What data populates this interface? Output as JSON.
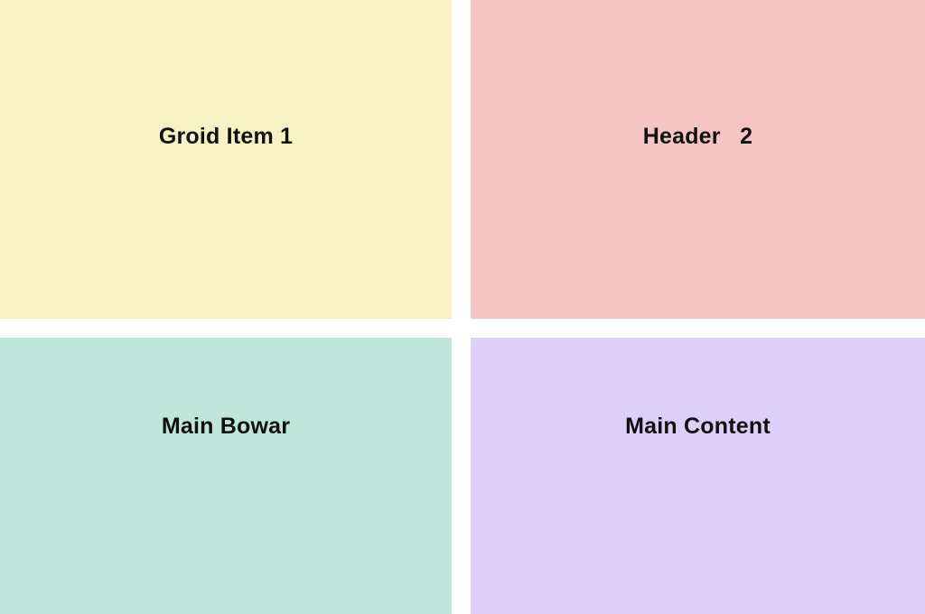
{
  "grid": {
    "items": [
      {
        "label": "Groid Item 1",
        "color": "#f8f1c4"
      },
      {
        "label": "Header   2",
        "color": "#f5c5c3"
      },
      {
        "label": "Main Bowar",
        "color": "#c0e5da"
      },
      {
        "label": "Main Content",
        "color": "#ddd0f8"
      }
    ]
  }
}
